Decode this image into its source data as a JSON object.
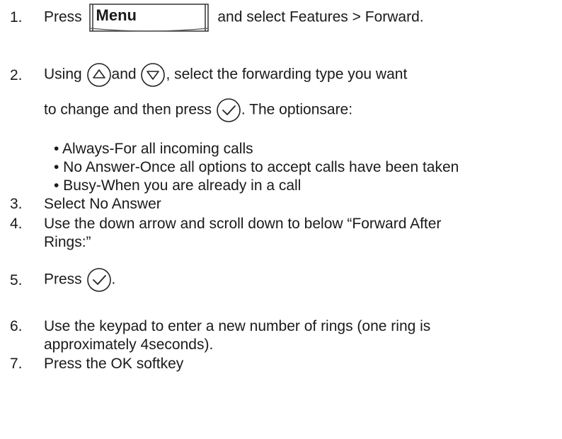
{
  "steps": [
    {
      "num": "1.",
      "before": "Press",
      "key_label": "Menu",
      "after": "and select Features > Forward."
    },
    {
      "num": "2.",
      "before": "Using",
      "mid": "and",
      "after": ", select the forwarding type you want",
      "line2_before": "to change and then press",
      "line2_after": ". The optionsare:"
    },
    {
      "num": "3.",
      "text": "Select No Answer"
    },
    {
      "num": "4.",
      "text": "Use the down arrow and scroll down to below “Forward After",
      "text2": "Rings:”"
    },
    {
      "num": "5.",
      "before": "Press",
      "after": "."
    },
    {
      "num": "6.",
      "text": "Use the keypad to enter a new number of rings (one ring is",
      "text2": "approximately 4seconds)."
    },
    {
      "num": "7.",
      "text": "Press the OK softkey"
    }
  ],
  "options": [
    "• Always-For all incoming calls",
    "• No Answer-Once all options to accept calls have been taken",
    "• Busy-When you are already in a call"
  ],
  "icons": {
    "menu_key": "menu-key-icon",
    "up": "up-arrow-icon",
    "down": "down-arrow-icon",
    "ok": "ok-check-icon"
  }
}
